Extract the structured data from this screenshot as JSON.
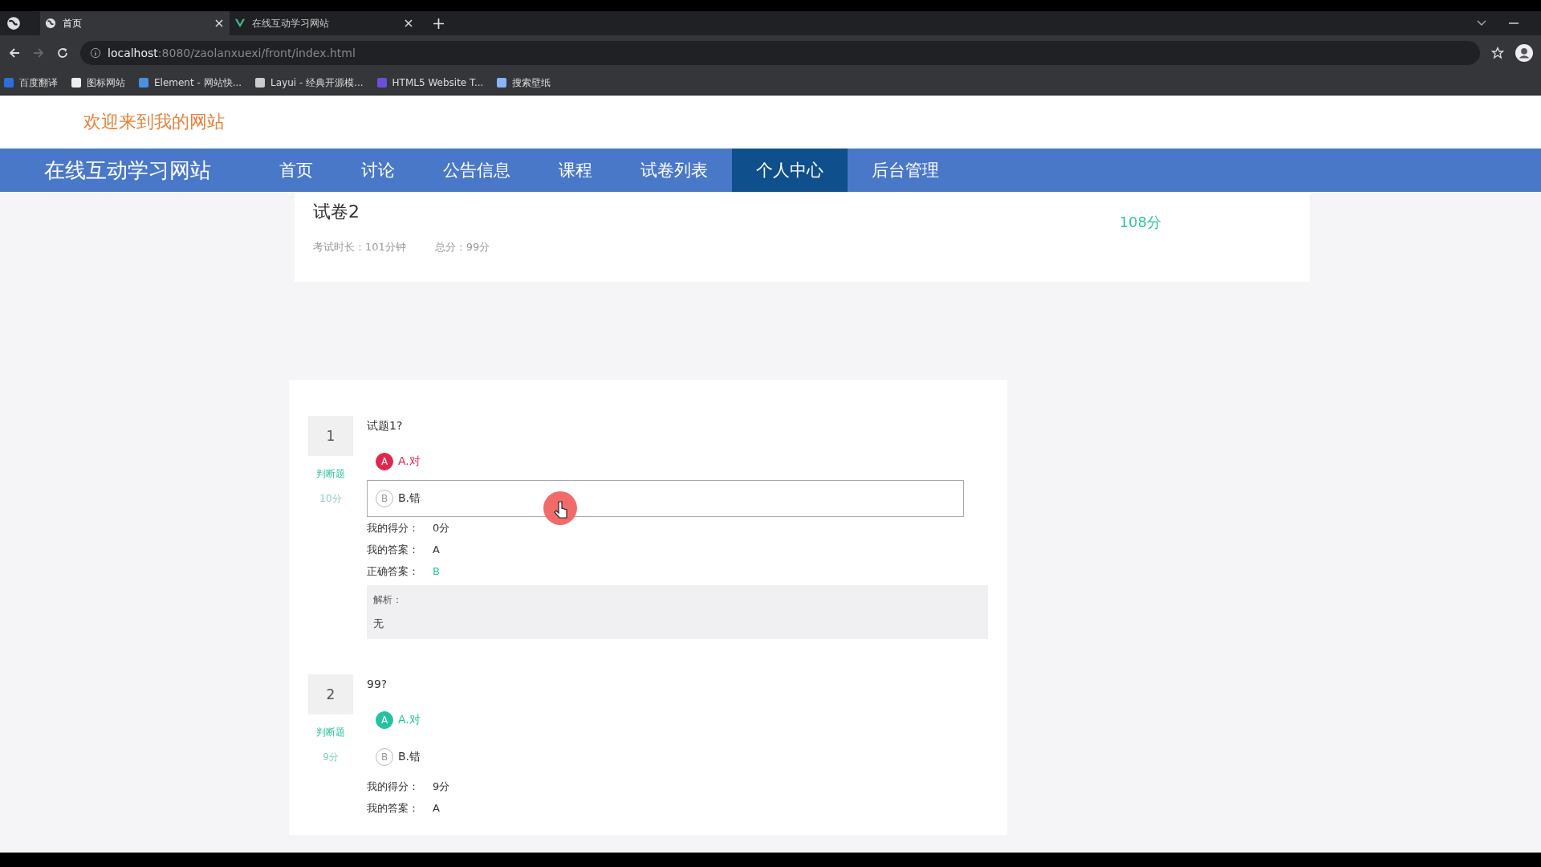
{
  "browser": {
    "tabs": [
      {
        "title": "首页",
        "selected": true
      },
      {
        "title": "在线互动学习网站",
        "selected": false
      }
    ],
    "url": {
      "host": "localhost",
      "path": ":8080/zaolanxuexi/front/index.html"
    },
    "bookmarks": [
      {
        "label": "百度翻译"
      },
      {
        "label": "图标网站"
      },
      {
        "label": "Element - 网站快..."
      },
      {
        "label": "Layui - 经典开源模..."
      },
      {
        "label": "HTML5 Website T..."
      },
      {
        "label": "搜索壁纸"
      }
    ]
  },
  "site": {
    "welcome": "欢迎来到我的网站",
    "brand": "在线互动学习网站",
    "nav": [
      {
        "label": "首页",
        "selected": false
      },
      {
        "label": "讨论",
        "selected": false
      },
      {
        "label": "公告信息",
        "selected": false
      },
      {
        "label": "课程",
        "selected": false
      },
      {
        "label": "试卷列表",
        "selected": false
      },
      {
        "label": "个人中心",
        "selected": true
      },
      {
        "label": "后台管理",
        "selected": false
      }
    ]
  },
  "exam": {
    "title": "试卷2",
    "meta": [
      {
        "label": "考试时长：",
        "value": "101分钟"
      },
      {
        "label": "总分：",
        "value": "99分"
      }
    ],
    "score": "108分"
  },
  "questions": [
    {
      "number": "1",
      "type": "判断题",
      "points": "10分",
      "text": "试题1?",
      "options": [
        {
          "letter": "A",
          "text": "A.对",
          "kind": "wrong",
          "hovered": false
        },
        {
          "letter": "B",
          "text": "B.错",
          "kind": "plain",
          "hovered": true
        }
      ],
      "results": [
        {
          "label": "我的得分：",
          "value": "0分",
          "kind": "plain"
        },
        {
          "label": "我的答案：",
          "value": "A",
          "kind": "plain"
        },
        {
          "label": "正确答案：",
          "value": "B",
          "kind": "correct"
        }
      ],
      "analysis": {
        "label": "解析：",
        "text": "无"
      }
    },
    {
      "number": "2",
      "type": "判断题",
      "points": "9分",
      "text": "99?",
      "options": [
        {
          "letter": "A",
          "text": "A.对",
          "kind": "right",
          "hovered": false
        },
        {
          "letter": "B",
          "text": "B.错",
          "kind": "plain",
          "hovered": false
        }
      ],
      "results": [
        {
          "label": "我的得分：",
          "value": "9分",
          "kind": "plain"
        },
        {
          "label": "我的答案：",
          "value": "A",
          "kind": "plain"
        }
      ]
    }
  ]
}
